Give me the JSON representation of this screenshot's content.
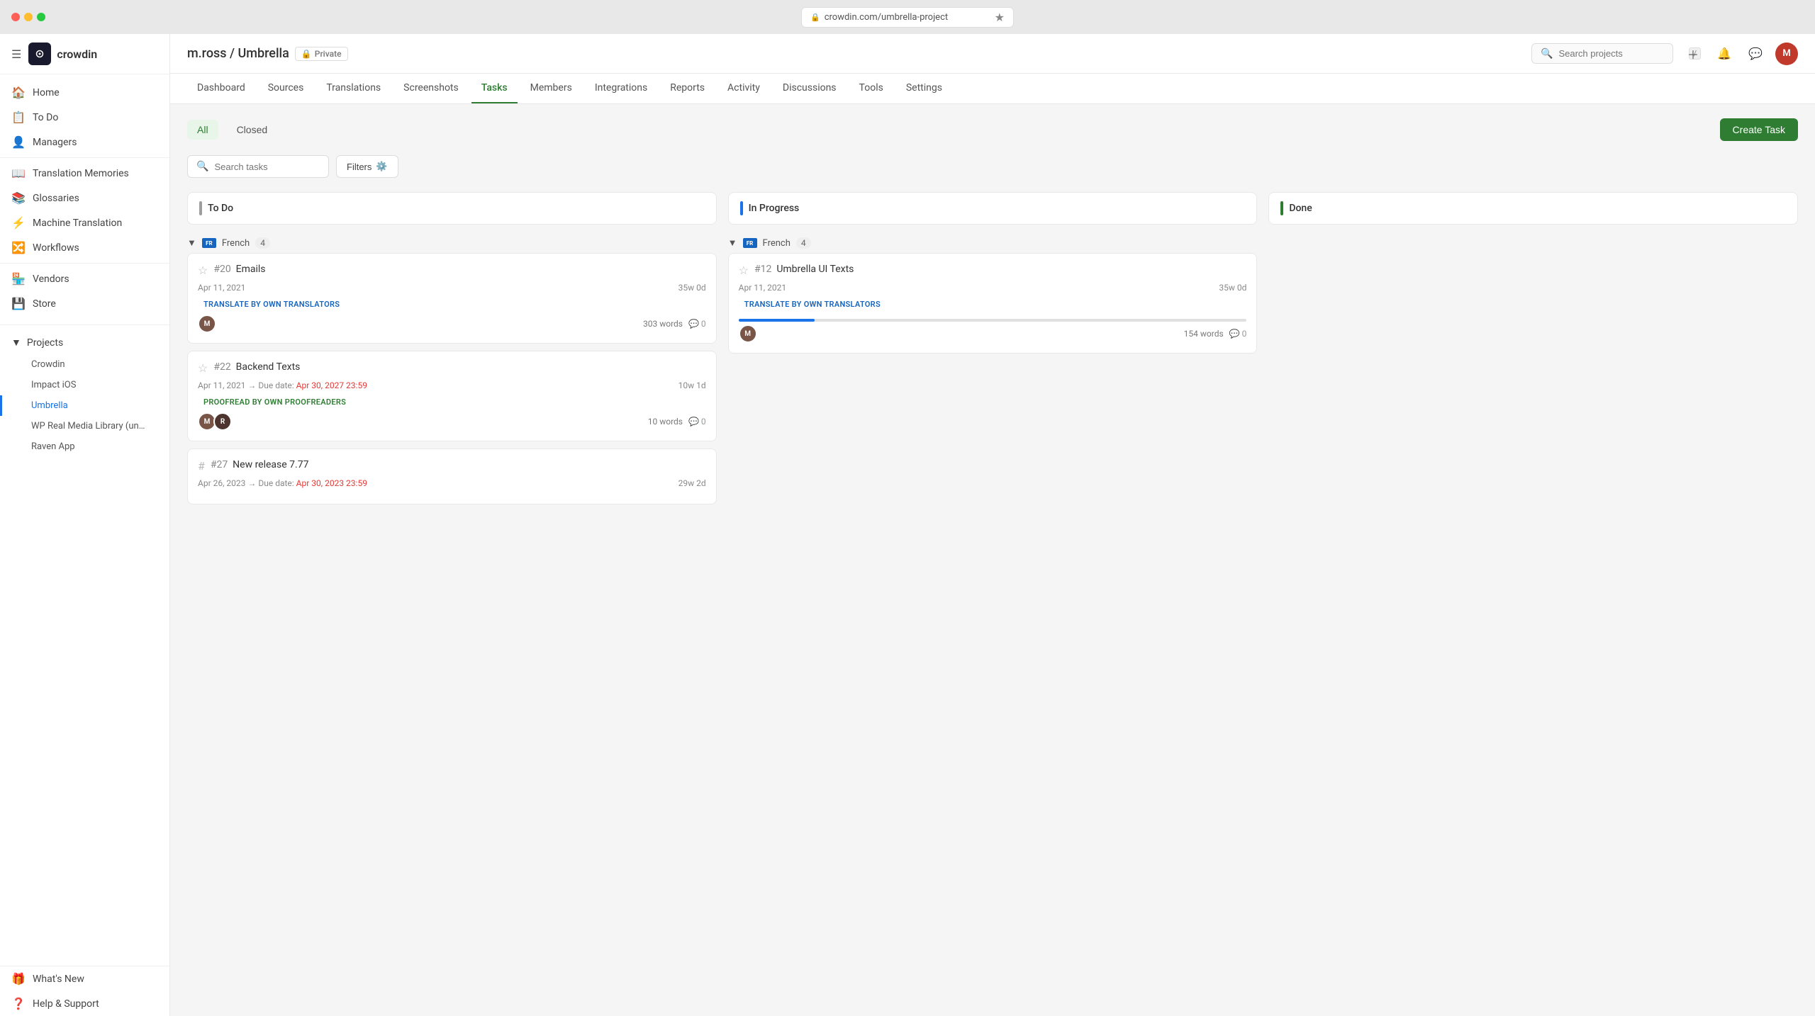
{
  "window": {
    "url": "crowdin.com/umbrella-project",
    "traffic_lights": [
      "close",
      "minimize",
      "maximize"
    ]
  },
  "sidebar": {
    "brand": {
      "logo": "C",
      "name": "crowdin"
    },
    "nav_items": [
      {
        "id": "home",
        "label": "Home",
        "icon": "🏠"
      },
      {
        "id": "todo",
        "label": "To Do",
        "icon": "📋"
      },
      {
        "id": "managers",
        "label": "Managers",
        "icon": "👤"
      },
      {
        "id": "translation-memories",
        "label": "Translation Memories",
        "icon": "📖"
      },
      {
        "id": "glossaries",
        "label": "Glossaries",
        "icon": "📚"
      },
      {
        "id": "machine-translation",
        "label": "Machine Translation",
        "icon": "⚡"
      },
      {
        "id": "workflows",
        "label": "Workflows",
        "icon": "🔀"
      },
      {
        "id": "vendors",
        "label": "Vendors",
        "icon": "🏪"
      },
      {
        "id": "store",
        "label": "Store",
        "icon": "💾"
      }
    ],
    "projects_label": "Projects",
    "projects": [
      {
        "id": "crowdin",
        "label": "Crowdin"
      },
      {
        "id": "impact-ios",
        "label": "Impact iOS"
      },
      {
        "id": "umbrella",
        "label": "Umbrella",
        "active": true
      },
      {
        "id": "wp-real-media",
        "label": "WP Real Media Library (un…"
      },
      {
        "id": "raven-app",
        "label": "Raven App"
      }
    ],
    "bottom_items": [
      {
        "id": "whats-new",
        "label": "What's New",
        "icon": "🎁"
      },
      {
        "id": "help-support",
        "label": "Help & Support",
        "icon": "❓"
      }
    ]
  },
  "top_nav": {
    "project_path": "m.ross / Umbrella",
    "private_label": "Private",
    "search_placeholder": "Search projects",
    "kbd_shortcut": "/"
  },
  "tabs": [
    {
      "id": "dashboard",
      "label": "Dashboard"
    },
    {
      "id": "sources",
      "label": "Sources"
    },
    {
      "id": "translations",
      "label": "Translations"
    },
    {
      "id": "screenshots",
      "label": "Screenshots"
    },
    {
      "id": "tasks",
      "label": "Tasks",
      "active": true
    },
    {
      "id": "members",
      "label": "Members"
    },
    {
      "id": "integrations",
      "label": "Integrations"
    },
    {
      "id": "reports",
      "label": "Reports"
    },
    {
      "id": "activity",
      "label": "Activity"
    },
    {
      "id": "discussions",
      "label": "Discussions"
    },
    {
      "id": "tools",
      "label": "Tools"
    },
    {
      "id": "settings",
      "label": "Settings"
    }
  ],
  "tasks": {
    "filter_all": "All",
    "filter_closed": "Closed",
    "search_placeholder": "Search tasks",
    "filter_btn": "Filters",
    "create_task_btn": "Create Task",
    "columns": [
      {
        "id": "todo",
        "label": "To Do",
        "color": "gray"
      },
      {
        "id": "in-progress",
        "label": "In Progress",
        "color": "blue"
      },
      {
        "id": "done",
        "label": "Done",
        "color": "green"
      }
    ],
    "language_groups": [
      {
        "id": "french",
        "flag": "FR",
        "language": "French",
        "count": 4,
        "todo_tasks": [
          {
            "id": "task-20",
            "num": "#20",
            "title": "Emails",
            "starred": false,
            "date": "Apr 11, 2021",
            "due_date": null,
            "duration": "35w 0d",
            "badge_type": "translate",
            "badge_label": "TRANSLATE BY OWN TRANSLATORS",
            "words": "303 words",
            "progress": 0,
            "comments": 0
          },
          {
            "id": "task-22",
            "num": "#22",
            "title": "Backend Texts",
            "starred": false,
            "date": "Apr 11, 2021",
            "due_date": "Apr 30, 2027 23:59",
            "duration": "10w 1d",
            "badge_type": "proofread",
            "badge_label": "PROOFREAD BY OWN PROOFREADERS",
            "words": "10 words",
            "progress": 0,
            "comments": 0
          },
          {
            "id": "task-27",
            "num": "#27",
            "title": "New release 7.77",
            "starred": false,
            "date": "Apr 26, 2023",
            "due_date": "Apr 30, 2023 23:59",
            "duration": "29w 2d",
            "badge_type": null,
            "badge_label": null,
            "words": null,
            "progress": 0,
            "comments": 0
          }
        ],
        "in_progress_tasks": [
          {
            "id": "task-12",
            "num": "#12",
            "title": "Umbrella UI Texts",
            "starred": false,
            "date": "Apr 11, 2021",
            "due_date": null,
            "duration": "35w 0d",
            "badge_type": "translate",
            "badge_label": "TRANSLATE BY OWN TRANSLATORS",
            "words": "154 words",
            "progress": 15,
            "comments": 0
          }
        ]
      }
    ]
  }
}
